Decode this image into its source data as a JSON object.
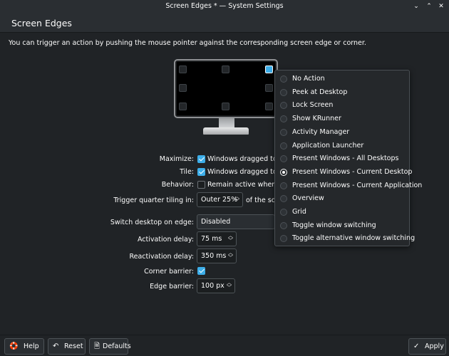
{
  "window": {
    "title": "Screen Edges * — System Settings",
    "minimize_glyph": "⌄",
    "maximize_glyph": "⌃",
    "close_glyph": "✕"
  },
  "page": {
    "title": "Screen Edges",
    "description": "You can trigger an action by pushing the mouse pointer against the corresponding screen edge or corner."
  },
  "monitor": {
    "edges": [
      {
        "id": "top-left",
        "active": false
      },
      {
        "id": "top",
        "active": false
      },
      {
        "id": "top-right",
        "active": true
      },
      {
        "id": "left",
        "active": false
      },
      {
        "id": "right",
        "active": false
      },
      {
        "id": "bottom-left",
        "active": false
      },
      {
        "id": "bottom",
        "active": false
      },
      {
        "id": "bottom-right",
        "active": false
      }
    ]
  },
  "form": {
    "maximize_label": "Maximize:",
    "maximize_checked": true,
    "maximize_text": "Windows dragged to top",
    "tile_label": "Tile:",
    "tile_checked": true,
    "tile_text": "Windows dragged to left",
    "behavior_label": "Behavior:",
    "behavior_checked": false,
    "behavior_text": "Remain active when win",
    "quarter_label": "Trigger quarter tiling in:",
    "quarter_value": "Outer 25%",
    "quarter_suffix": "of the scre",
    "switch_label": "Switch desktop on edge:",
    "switch_value": "Disabled",
    "activation_label": "Activation delay:",
    "activation_value": "75 ms",
    "reactivation_label": "Reactivation delay:",
    "reactivation_value": "350 ms",
    "corner_barrier_label": "Corner barrier:",
    "corner_barrier_checked": true,
    "edge_barrier_label": "Edge barrier:",
    "edge_barrier_value": "100 px"
  },
  "menu": {
    "selected_index": 7,
    "items": [
      "No Action",
      "Peek at Desktop",
      "Lock Screen",
      "Show KRunner",
      "Activity Manager",
      "Application Launcher",
      "Present Windows - All Desktops",
      "Present Windows - Current Desktop",
      "Present Windows - Current Application",
      "Overview",
      "Grid",
      "Toggle window switching",
      "Toggle alternative window switching"
    ]
  },
  "footer": {
    "help_label": "Help",
    "help_icon": "help-icon",
    "reset_label": "Reset",
    "reset_icon": "undo-icon",
    "defaults_label": "Defaults",
    "defaults_icon": "document-icon",
    "apply_label": "Apply",
    "apply_icon": "checkmark-icon"
  },
  "colors": {
    "accent": "#3daee9",
    "background": "#202326",
    "surface": "#2a2e32"
  }
}
